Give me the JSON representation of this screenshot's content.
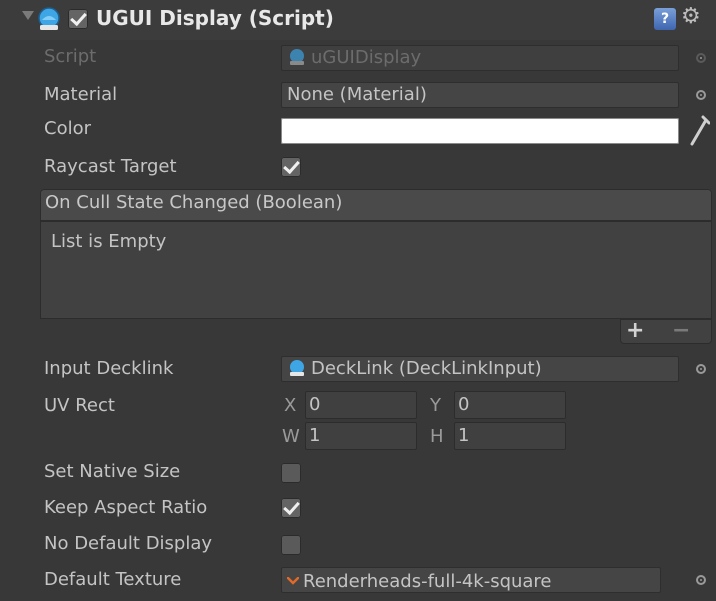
{
  "component": {
    "title": "UGUI Display (Script)",
    "enabled": true
  },
  "fields": {
    "script": {
      "label": "Script",
      "value": "uGUIDisplay"
    },
    "material": {
      "label": "Material",
      "value": "None (Material)"
    },
    "color": {
      "label": "Color",
      "value_hex": "#ffffff"
    },
    "raycast_target": {
      "label": "Raycast Target",
      "checked": true
    },
    "input_decklink": {
      "label": "Input Decklink",
      "value": "DeckLink (DeckLinkInput)"
    },
    "uv_rect": {
      "label": "UV Rect",
      "x_label": "X",
      "x": "0",
      "y_label": "Y",
      "y": "0",
      "w_label": "W",
      "w": "1",
      "h_label": "H",
      "h": "1"
    },
    "set_native_size": {
      "label": "Set Native Size",
      "checked": false
    },
    "keep_aspect_ratio": {
      "label": "Keep Aspect Ratio",
      "checked": true
    },
    "no_default_display": {
      "label": "No Default Display",
      "checked": false
    },
    "default_texture": {
      "label": "Default Texture",
      "value": "Renderheads-full-4k-square"
    }
  },
  "event": {
    "header": "On Cull State Changed (Boolean)",
    "empty_text": "List is Empty",
    "add_label": "+",
    "remove_label": "−"
  },
  "icons": {
    "help": "?",
    "gear": "⚙"
  },
  "colors": {
    "background": "#383838",
    "script_icon": "#3fa6e6"
  }
}
